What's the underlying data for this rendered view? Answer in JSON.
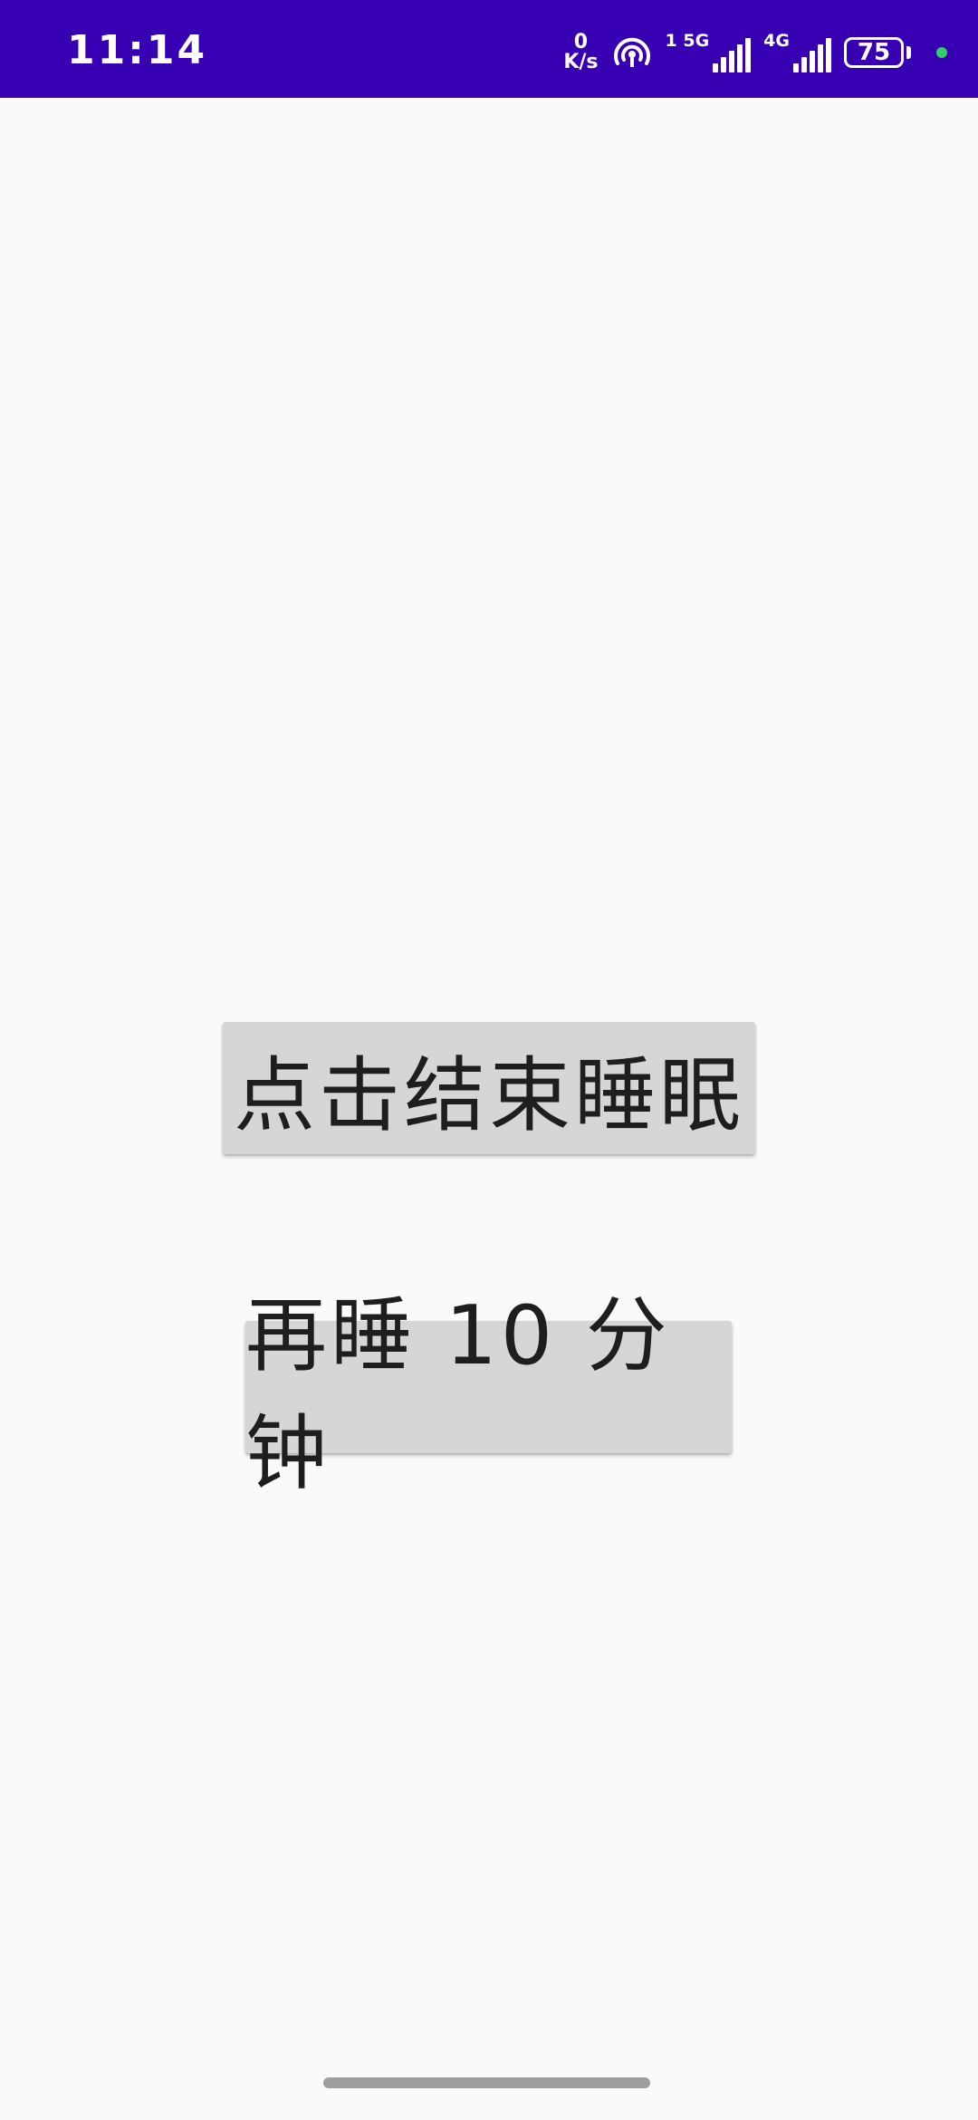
{
  "status_bar": {
    "time": "11:14",
    "net_speed_value": "0",
    "net_speed_unit": "K/s",
    "sim1_label": "1 5G",
    "sim2_label": "4G",
    "battery_percent": "75",
    "background_color": "#3700b3",
    "icons": [
      "hotspot-icon",
      "signal-icon",
      "battery-icon"
    ]
  },
  "main": {
    "end_sleep_label": "点击结束睡眠",
    "snooze_label": "再睡 10 分钟"
  },
  "colors": {
    "background": "#fafafa",
    "button_bg": "#d6d6d6",
    "button_text": "#1e1e1e",
    "indicator_dot": "#33cc66"
  }
}
